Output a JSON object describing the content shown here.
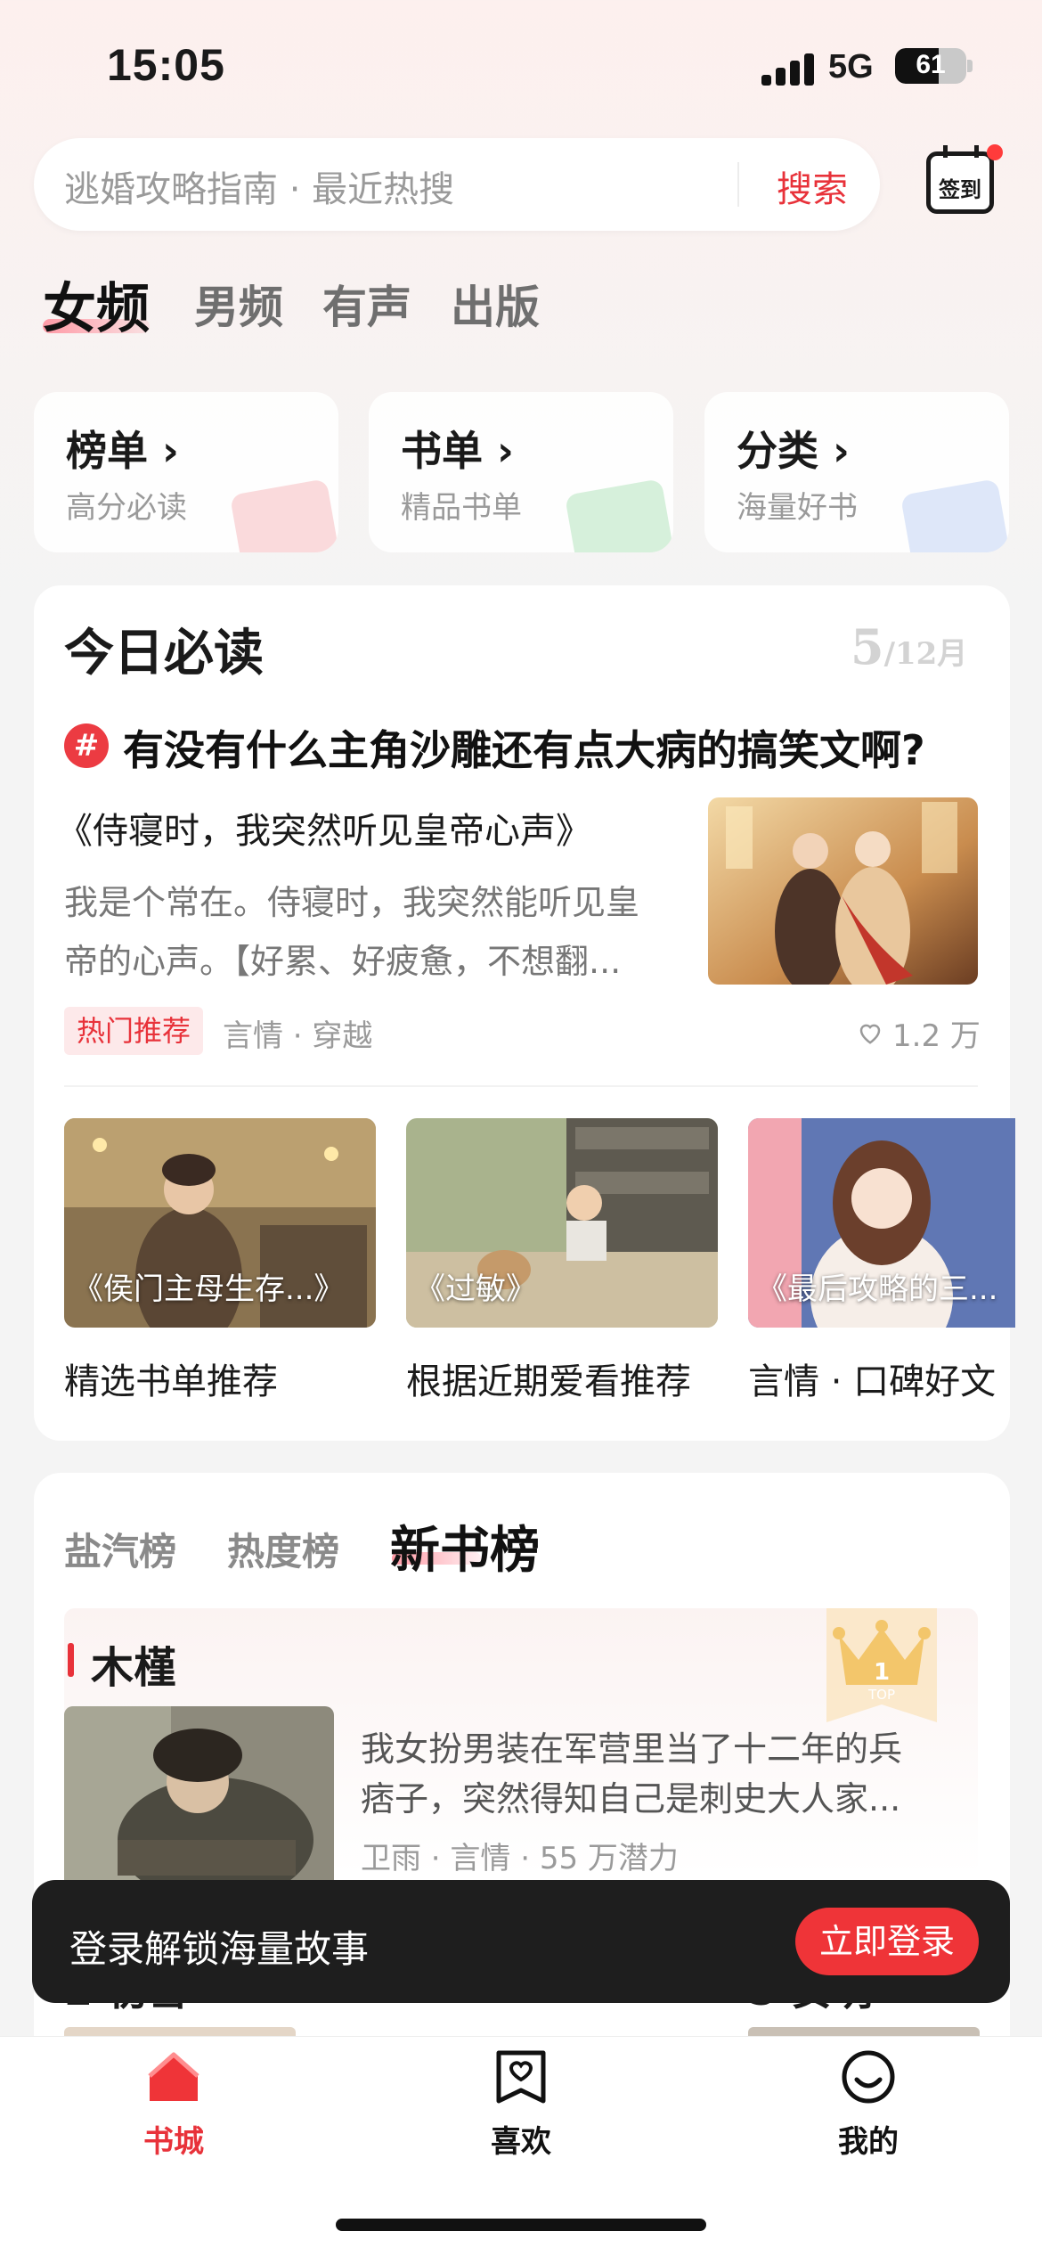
{
  "status_bar": {
    "time": "15:05",
    "network": "5G",
    "battery": "61",
    "battery_level": 0.61
  },
  "search": {
    "placeholder": "逃婚攻略指南 · 最近热搜",
    "button": "搜索",
    "checkin_label": "签到"
  },
  "channels": [
    {
      "label": "女频",
      "active": true
    },
    {
      "label": "男频",
      "active": false
    },
    {
      "label": "有声",
      "active": false
    },
    {
      "label": "出版",
      "active": false
    }
  ],
  "shortcuts": [
    {
      "title": "榜单",
      "arrow": "›",
      "subtitle": "高分必读",
      "color": "#f7b0b3"
    },
    {
      "title": "书单",
      "arrow": "›",
      "subtitle": "精品书单",
      "color": "#a6dfb2"
    },
    {
      "title": "分类",
      "arrow": "›",
      "subtitle": "海量好书",
      "color": "#b9cdf3"
    }
  ],
  "today": {
    "title": "今日必读",
    "date_day": "5",
    "date_month": "/12月",
    "topic_icon": "#",
    "topic": "有没有什么主角沙雕还有点大病的搞笑文啊?",
    "book_title": "《侍寝时，我突然听见皇帝心声》",
    "book_desc_lines": [
      "我是个常在。侍寝时，我突然能听见皇",
      "帝的心声。【好累、好疲惫，不想翻..."
    ],
    "tag": "热门推荐",
    "meta": "言情 · 穿越",
    "likes": "1.2 万",
    "recommendations": [
      {
        "caption": "《侯门主母生存...》",
        "label": "精选书单推荐"
      },
      {
        "caption": "《过敏》",
        "label": "根据近期爱看推荐"
      },
      {
        "caption": "《最后攻略的三...",
        "label": "言情 · 口碑好文"
      }
    ]
  },
  "ranking": {
    "tabs": [
      {
        "label": "盐汽榜",
        "active": false
      },
      {
        "label": "热度榜",
        "active": false
      },
      {
        "label": "新书榜",
        "active": true
      }
    ],
    "top_item": {
      "author": "木槿",
      "badge_rank": "1",
      "badge_text": "TOP",
      "desc_lines": [
        "我女扮男装在军营里当了十二年的兵",
        "痞子，突然得知自己是刺史大人家..."
      ],
      "meta": "卫雨 · 言情 · 55 万潜力"
    },
    "next_items": [
      {
        "label": "2 初雪"
      },
      {
        "label": "5 安明"
      }
    ]
  },
  "login_banner": {
    "text": "登录解锁海量故事",
    "button": "立即登录"
  },
  "tabbar": [
    {
      "label": "书城",
      "icon": "bookstore-icon",
      "active": true
    },
    {
      "label": "喜欢",
      "icon": "favorites-icon",
      "active": false
    },
    {
      "label": "我的",
      "icon": "profile-icon",
      "active": false
    }
  ],
  "colors": {
    "accent": "#e8323a",
    "banner_bg": "#1e1e1e",
    "login_button": "#ef3438"
  }
}
